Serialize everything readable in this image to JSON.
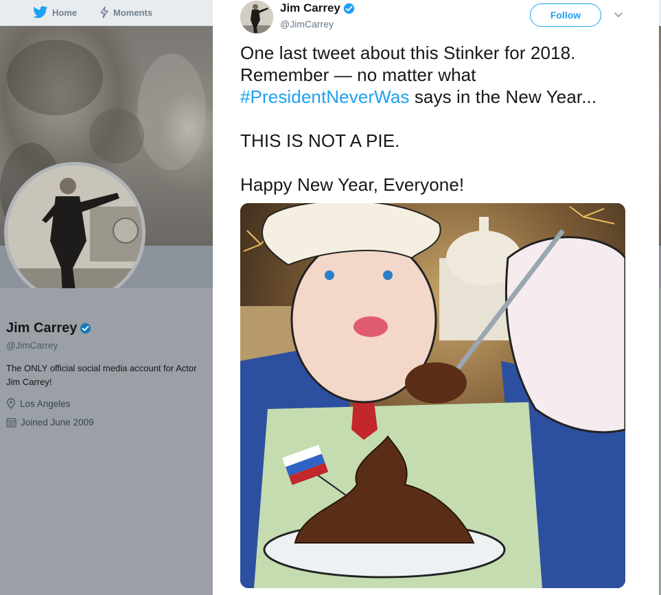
{
  "nav": {
    "home_label": "Home",
    "moments_label": "Moments"
  },
  "profile": {
    "name": "Jim Carrey",
    "handle": "@JimCarrey",
    "bio": "The ONLY official social media account for Actor Jim Carrey!",
    "location": "Los Angeles",
    "joined": "Joined June 2009"
  },
  "tweet": {
    "author_name": "Jim Carrey",
    "author_handle": "@JimCarrey",
    "follow_label": "Follow",
    "line1": "One last tweet about this Stinker for 2018.",
    "line2": "Remember — no matter what",
    "hashtag": "#PresidentNeverWas",
    "line3_rest": " says in the New Year...",
    "line4": "THIS IS NOT A PIE.",
    "line5": "Happy New Year, Everyone!"
  },
  "colors": {
    "brand_blue": "#1da1f2",
    "text": "#14171a",
    "muted": "#657786"
  },
  "icons": [
    "twitter-bird-icon",
    "moments-lightning-icon",
    "verified-badge-icon",
    "location-pin-icon",
    "calendar-icon",
    "chevron-down-icon"
  ]
}
